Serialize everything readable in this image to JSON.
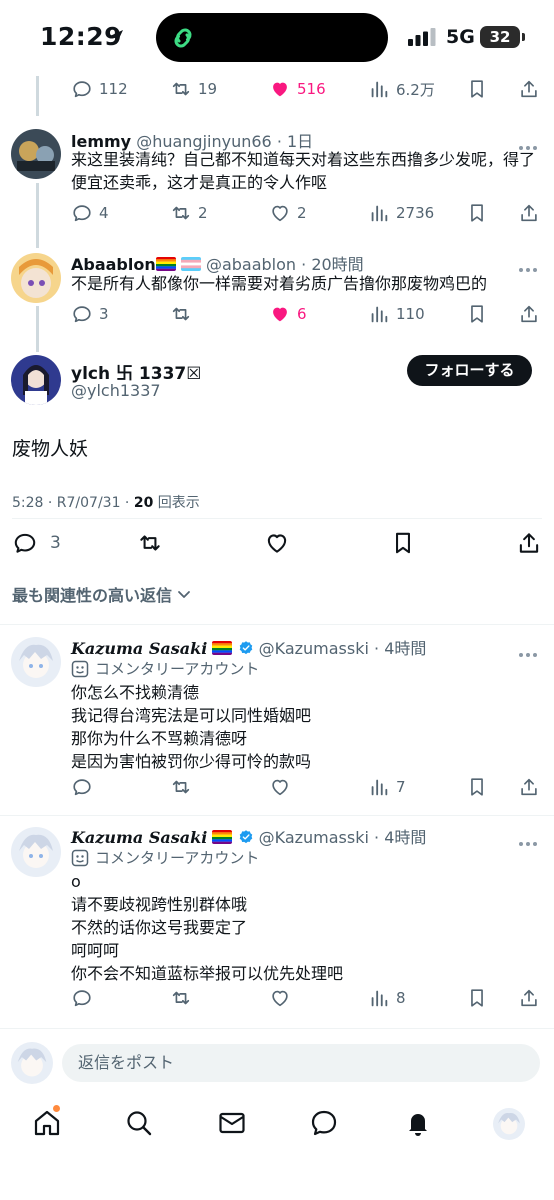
{
  "status": {
    "time": "12:29",
    "network": "5G",
    "battery": "32"
  },
  "top_tweet_actions": {
    "replies": "112",
    "retweets": "19",
    "likes": "516",
    "views": "6.2万"
  },
  "replies_above": [
    {
      "name": "lemmy",
      "handle": "@huangjinyun66",
      "time": "1日",
      "text": "来这里装清纯？自己都不知道每天对着这些东西撸多少发呢，得了\n便宜还卖乖，这才是真正的令人作呕",
      "replies": "4",
      "retweets": "2",
      "likes": "2",
      "views": "2736"
    },
    {
      "name": "Abaablon",
      "handle": "@abaablon",
      "time": "20時間",
      "text": "不是所有人都像你一样需要对着劣质广告撸你那废物鸡巴的",
      "replies": "3",
      "likes": "6",
      "views": "110"
    }
  ],
  "main_post": {
    "name": "ylch 卐 1337☒",
    "handle": "@ylch1337",
    "follow_label": "フォローする",
    "text": "废物人妖",
    "meta_time": "5:28 · R7/07/31 · ",
    "views_count": "20",
    "views_label": "回表示",
    "replies": "3"
  },
  "sort_label": "最も関連性の高い返信",
  "replies_below": [
    {
      "name": "Kazuma Sasaki",
      "handle": "@Kazumasski",
      "time": "4時間",
      "commentary": "コメンタリーアカウント",
      "text": "你怎么不找赖清德\n我记得台湾宪法是可以同性婚姻吧\n那你为什么不骂赖清德呀\n是因为害怕被罚你少得可怜的款吗",
      "views": "7"
    },
    {
      "name": "Kazuma Sasaki",
      "handle": "@Kazumasski",
      "time": "4時間",
      "commentary": "コメンタリーアカウント",
      "text": "o\n请不要歧视跨性别群体哦\n不然的话你这号我要定了\n呵呵呵\n你不会不知道蓝标举报可以优先处理吧",
      "views": "8"
    }
  ],
  "reply_placeholder": "返信をポスト",
  "colors": {
    "like": "#f91880",
    "text": "#0f1419",
    "secondary": "#536471",
    "verified": "#1d9bf0"
  },
  "icons": [
    "reply-icon",
    "retweet-icon",
    "like-icon",
    "views-icon",
    "bookmark-icon",
    "share-icon",
    "home-icon",
    "search-icon",
    "mail-icon",
    "grok-icon",
    "bell-icon"
  ]
}
